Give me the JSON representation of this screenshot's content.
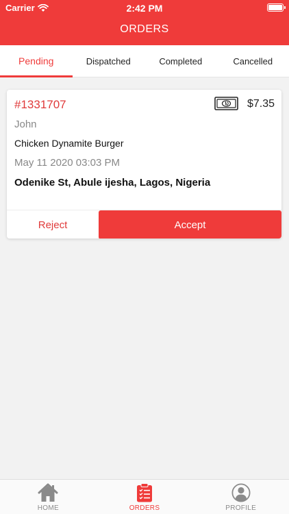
{
  "status_bar": {
    "carrier": "Carrier",
    "time": "2:42 PM"
  },
  "header": {
    "title": "ORDERS"
  },
  "tabs": [
    {
      "label": "Pending",
      "active": true
    },
    {
      "label": "Dispatched",
      "active": false
    },
    {
      "label": "Completed",
      "active": false
    },
    {
      "label": "Cancelled",
      "active": false
    }
  ],
  "order": {
    "id": "#1331707",
    "payment_icon": "cash-icon",
    "price": "$7.35",
    "customer": "John",
    "item": "Chicken Dynamite Burger",
    "datetime": "May 11 2020 03:03 PM",
    "address": "Odenike St, Abule ijesha, Lagos, Nigeria",
    "reject_label": "Reject",
    "accept_label": "Accept"
  },
  "bottom_nav": [
    {
      "label": "HOME",
      "icon": "home-icon",
      "active": false
    },
    {
      "label": "ORDERS",
      "icon": "clipboard-icon",
      "active": true
    },
    {
      "label": "PROFILE",
      "icon": "user-icon",
      "active": false
    }
  ],
  "colors": {
    "accent": "#ef3b3a",
    "muted": "#888888"
  }
}
